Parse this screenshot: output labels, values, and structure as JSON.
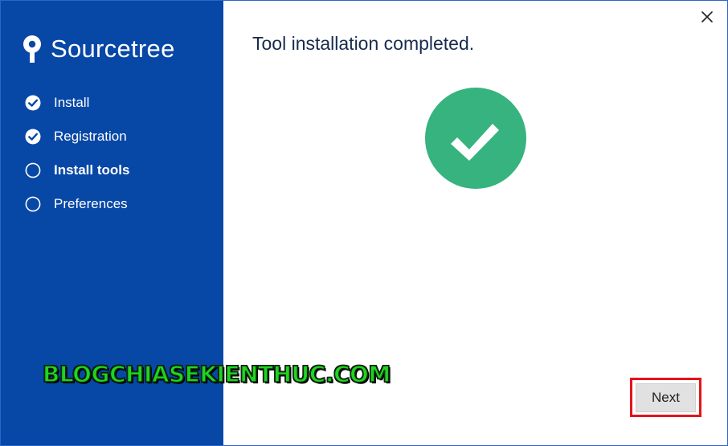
{
  "app": {
    "logo_text": "Sourcetree",
    "logo_icon": "sourcetree-logo-icon"
  },
  "sidebar": {
    "background": "#0747a6",
    "steps": [
      {
        "label": "Install",
        "status": "completed",
        "icon": "check-circle-icon"
      },
      {
        "label": "Registration",
        "status": "completed",
        "icon": "check-circle-icon"
      },
      {
        "label": "Install tools",
        "status": "current",
        "icon": "circle-icon"
      },
      {
        "label": "Preferences",
        "status": "pending",
        "icon": "circle-icon"
      }
    ]
  },
  "main": {
    "title": "Tool installation completed.",
    "status_icon": "success-check-icon",
    "status_color": "#36b37e",
    "next_label": "Next",
    "close_icon": "close-icon"
  },
  "watermark": {
    "text": "BLOGCHIASEKIENTHUC.COM",
    "color": "#21d321"
  },
  "highlight": {
    "color": "#e3141b"
  }
}
